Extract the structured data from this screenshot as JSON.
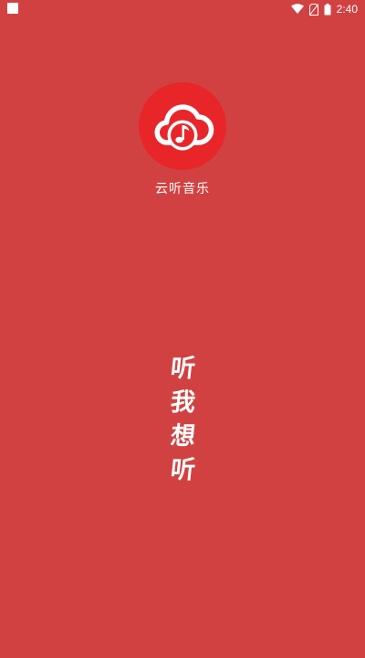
{
  "status_bar": {
    "time": "2:40",
    "icons": [
      "notification-icon",
      "wifi-icon",
      "no-sim-icon",
      "battery-icon"
    ]
  },
  "splash": {
    "app_name": "云听音乐",
    "slogan_chars": [
      "听",
      "我",
      "想",
      "听"
    ],
    "logo_icon": "cloud-music-note-icon"
  },
  "colors": {
    "background": "#d24141",
    "logo_circle": "#e8262a",
    "text": "#ffffff"
  }
}
